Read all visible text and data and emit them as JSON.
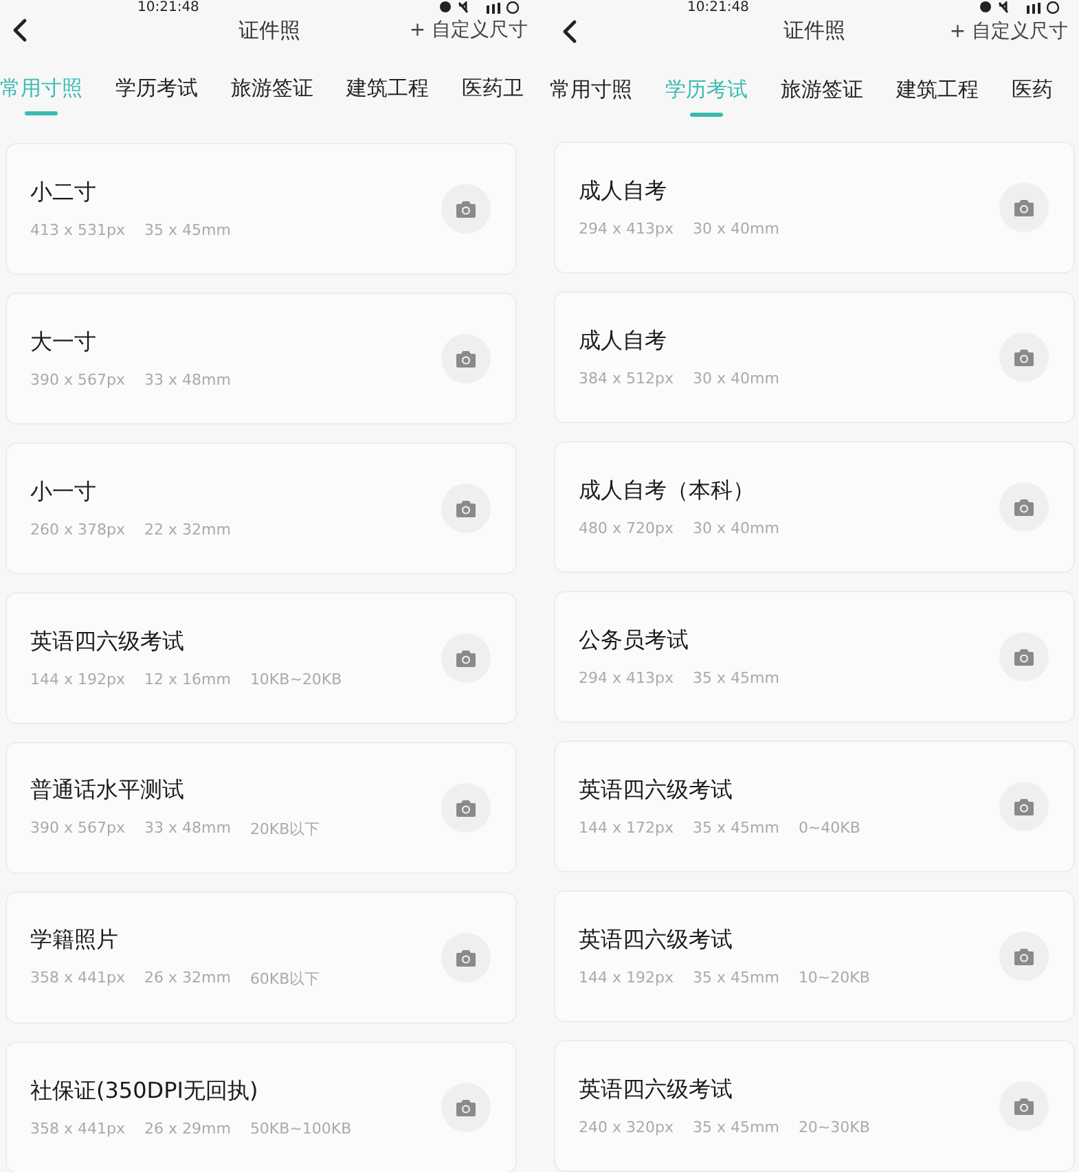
{
  "panels": [
    {
      "status_bar": {
        "time": "10:21:48"
      },
      "header": {
        "title": "证件照",
        "action": "+ 自定义尺寸"
      },
      "tabs": [
        {
          "label": "常用寸照",
          "selected": true
        },
        {
          "label": "学历考试",
          "selected": false
        },
        {
          "label": "旅游签证",
          "selected": false
        },
        {
          "label": "建筑工程",
          "selected": false
        },
        {
          "label": "医药卫",
          "selected": false
        }
      ],
      "cards": [
        {
          "name": "小二寸",
          "specs": [
            "413 x 531px",
            "35 x 45mm"
          ]
        },
        {
          "name": "大一寸",
          "specs": [
            "390 x 567px",
            "33 x 48mm"
          ]
        },
        {
          "name": "小一寸",
          "specs": [
            "260 x 378px",
            "22 x 32mm"
          ]
        },
        {
          "name": "英语四六级考试",
          "specs": [
            "144 x 192px",
            "12 x 16mm",
            "10KB~20KB"
          ]
        },
        {
          "name": "普通话水平测试",
          "specs": [
            "390 x 567px",
            "33 x 48mm",
            "20KB以下"
          ]
        },
        {
          "name": "学籍照片",
          "specs": [
            "358 x 441px",
            "26 x 32mm",
            "60KB以下"
          ]
        },
        {
          "name": "社保证(350DPI无回执)",
          "specs": [
            "358 x 441px",
            "26 x 29mm",
            "50KB~100KB"
          ]
        }
      ]
    },
    {
      "status_bar": {
        "time": "10:21:48"
      },
      "header": {
        "title": "证件照",
        "action": "+ 自定义尺寸"
      },
      "tabs": [
        {
          "label": "常用寸照",
          "selected": false
        },
        {
          "label": "学历考试",
          "selected": true
        },
        {
          "label": "旅游签证",
          "selected": false
        },
        {
          "label": "建筑工程",
          "selected": false
        },
        {
          "label": "医药",
          "selected": false
        }
      ],
      "cards": [
        {
          "name": "成人自考",
          "specs": [
            "294 x 413px",
            "30 x 40mm"
          ]
        },
        {
          "name": "成人自考",
          "specs": [
            "384 x 512px",
            "30 x 40mm"
          ]
        },
        {
          "name": "成人自考（本科）",
          "specs": [
            "480 x 720px",
            "30 x 40mm"
          ]
        },
        {
          "name": "公务员考试",
          "specs": [
            "294 x 413px",
            "35 x 45mm"
          ]
        },
        {
          "name": "英语四六级考试",
          "specs": [
            "144 x 172px",
            "35 x 45mm",
            "0~40KB"
          ]
        },
        {
          "name": "英语四六级考试",
          "specs": [
            "144 x 192px",
            "35 x 45mm",
            "10~20KB"
          ]
        },
        {
          "name": "英语四六级考试",
          "specs": [
            "240 x 320px",
            "35 x 45mm",
            "20~30KB"
          ]
        }
      ]
    }
  ]
}
